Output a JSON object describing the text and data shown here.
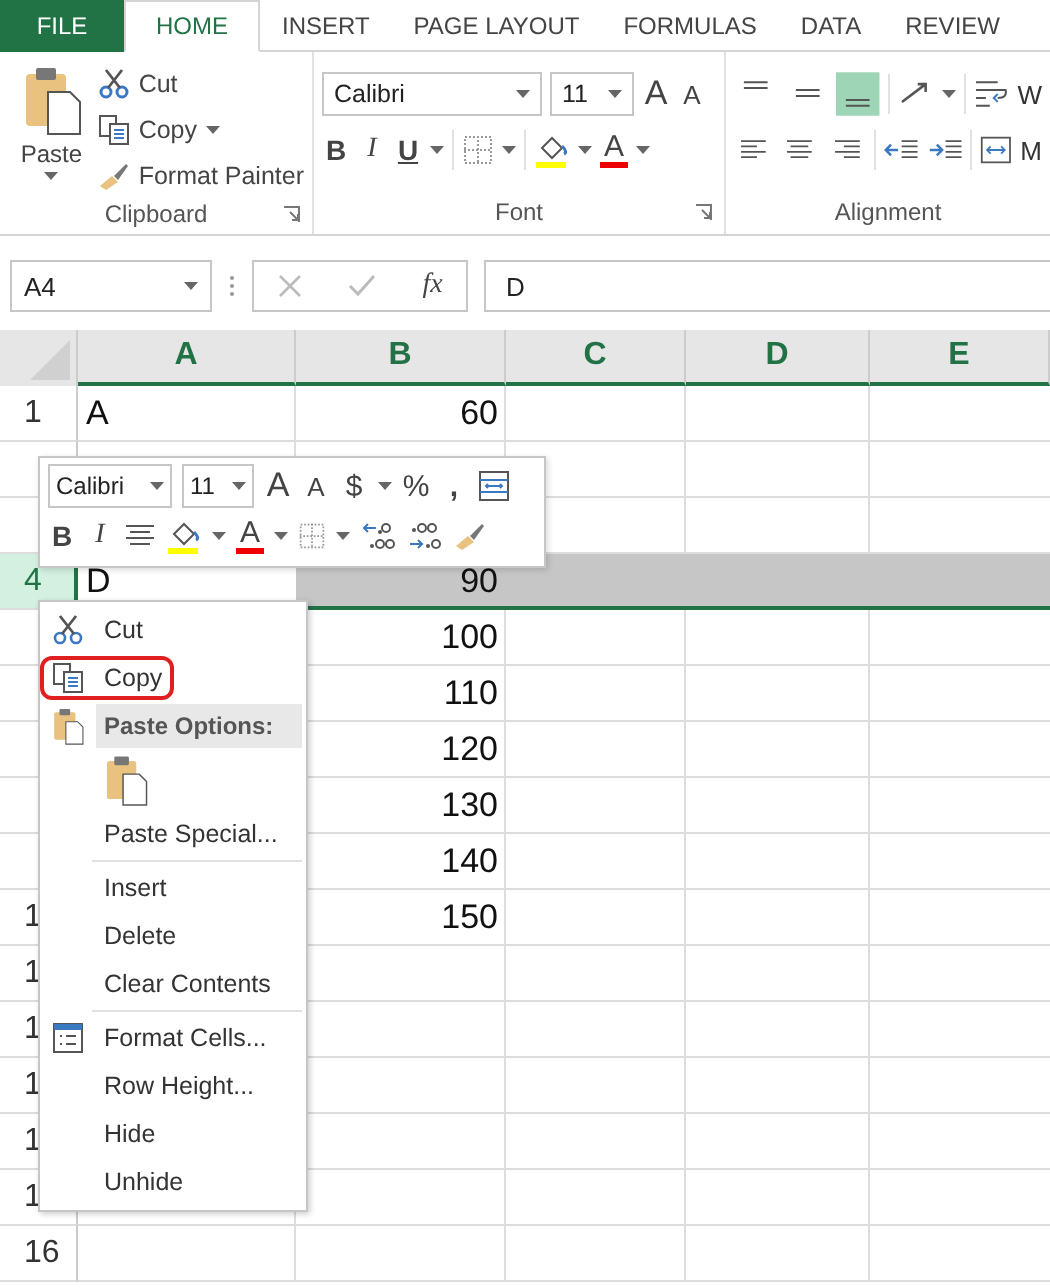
{
  "tabs": [
    {
      "label": "FILE",
      "kind": "file",
      "selected": false
    },
    {
      "label": "HOME",
      "kind": "tab",
      "selected": true
    },
    {
      "label": "INSERT",
      "kind": "tab",
      "selected": false
    },
    {
      "label": "PAGE LAYOUT",
      "kind": "tab",
      "selected": false
    },
    {
      "label": "FORMULAS",
      "kind": "tab",
      "selected": false
    },
    {
      "label": "DATA",
      "kind": "tab",
      "selected": false
    },
    {
      "label": "REVIEW",
      "kind": "tab",
      "selected": false
    }
  ],
  "ribbon": {
    "clipboard": {
      "paste": "Paste",
      "cut": "Cut",
      "copy": "Copy",
      "format_painter": "Format Painter",
      "label": "Clipboard"
    },
    "font": {
      "font_name": "Calibri",
      "font_size": "11",
      "grow": "A",
      "shrink": "A",
      "bold": "B",
      "italic": "I",
      "underline": "U",
      "font_color": "A",
      "label": "Font"
    },
    "alignment": {
      "vertical": [
        {
          "selected": false
        },
        {
          "selected": false
        },
        {
          "selected": true
        }
      ],
      "wrap": "W",
      "merge": "M",
      "label": "Alignment"
    }
  },
  "formula_bar": {
    "name_box": "A4",
    "function_label": "fx",
    "value": "D"
  },
  "columns": [
    "A",
    "B",
    "C",
    "D",
    "E"
  ],
  "rows": [
    {
      "header": "1",
      "a": "A",
      "b": "60",
      "selected": false
    },
    {
      "selected": false
    },
    {
      "selected": false
    },
    {
      "header": "4",
      "a": "D",
      "b": "90",
      "selected": true
    },
    {
      "b": "100",
      "selected": false
    },
    {
      "b": "110",
      "selected": false
    },
    {
      "b": "120",
      "selected": false
    },
    {
      "b": "130",
      "selected": false
    },
    {
      "b": "140",
      "selected": false
    },
    {
      "header": "1",
      "b": "150",
      "selected": false
    },
    {
      "header": "1",
      "selected": false
    },
    {
      "header": "1",
      "selected": false
    },
    {
      "header": "1",
      "selected": false
    },
    {
      "header": "1",
      "selected": false
    },
    {
      "header": "1",
      "selected": false
    },
    {
      "header": "16",
      "selected": false
    }
  ],
  "mini_toolbar": {
    "font_name": "Calibri",
    "font_size": "11",
    "grow": "A",
    "shrink": "A",
    "currency": "$",
    "percent": "%",
    "comma": ",",
    "bold": "B",
    "italic": "I",
    "font_color": "A"
  },
  "context_menu": [
    {
      "kind": "cut",
      "label": "Cut"
    },
    {
      "kind": "copy",
      "label": "Copy",
      "highlighted": true
    },
    {
      "kind": "paste-header",
      "label": "Paste Options:"
    },
    {
      "kind": "paste-option"
    },
    {
      "kind": "plain",
      "label": "Paste Special..."
    },
    {
      "kind": "separator"
    },
    {
      "kind": "plain",
      "label": "Insert"
    },
    {
      "kind": "plain",
      "label": "Delete"
    },
    {
      "kind": "plain",
      "label": "Clear Contents"
    },
    {
      "kind": "separator"
    },
    {
      "kind": "format",
      "label": "Format Cells..."
    },
    {
      "kind": "plain",
      "label": "Row Height..."
    },
    {
      "kind": "plain",
      "label": "Hide"
    },
    {
      "kind": "plain",
      "label": "Unhide"
    }
  ]
}
